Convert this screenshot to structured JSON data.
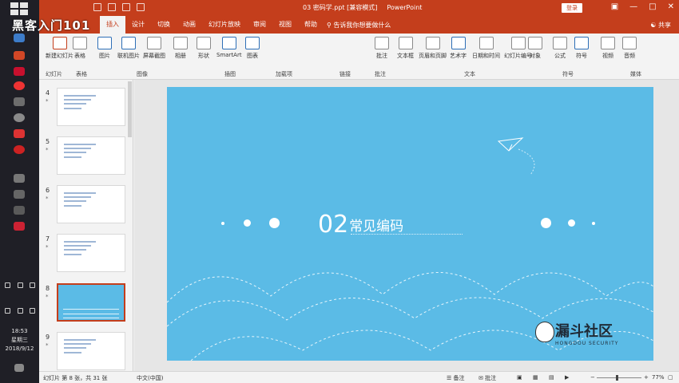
{
  "window": {
    "title": "03 密码学.ppt [兼容模式]",
    "app_name": "PowerPoint",
    "sign_in": "登录",
    "brand": "黑客入门101"
  },
  "tabs": [
    {
      "label": "插入",
      "active": true
    },
    {
      "label": "设计",
      "active": false
    },
    {
      "label": "切换",
      "active": false
    },
    {
      "label": "动画",
      "active": false
    },
    {
      "label": "幻灯片放映",
      "active": false
    },
    {
      "label": "审阅",
      "active": false
    },
    {
      "label": "视图",
      "active": false
    },
    {
      "label": "帮助",
      "active": false
    }
  ],
  "tell_me": "告诉我你想要做什么",
  "share": "共享",
  "ribbon": {
    "buttons": [
      "新建幻灯片",
      "表格",
      "图片",
      "联机图片",
      "屏幕截图",
      "相册",
      "形状",
      "SmartArt",
      "图表",
      "批注",
      "文本框",
      "页眉和页脚",
      "艺术字",
      "日期和时间",
      "幻灯片编号",
      "对象",
      "公式",
      "符号",
      "视频",
      "音频"
    ],
    "groups": [
      "幻灯片",
      "表格",
      "图像",
      "插图",
      "加载项",
      "链接",
      "批注",
      "文本",
      "符号",
      "媒体"
    ]
  },
  "slides": {
    "numbers": [
      "4",
      "5",
      "6",
      "7",
      "8",
      "9"
    ],
    "selected": "8"
  },
  "slide": {
    "number": "02",
    "title": "常见编码",
    "watermark_cn": "漏斗社区",
    "watermark_en": "HONGDOU SECURITY"
  },
  "status": {
    "slide_info": "幻灯片 第 8 张，共 31 张",
    "language": "中文(中国)",
    "notes": "备注",
    "comments": "批注",
    "zoom": "77%"
  },
  "taskbar": {
    "time": "18:53",
    "weekday": "星期三",
    "date": "2018/9/12"
  },
  "colors": {
    "accent": "#c43e1c",
    "slide_bg": "#5bbbe6",
    "taskbar": "#1f1f26"
  }
}
